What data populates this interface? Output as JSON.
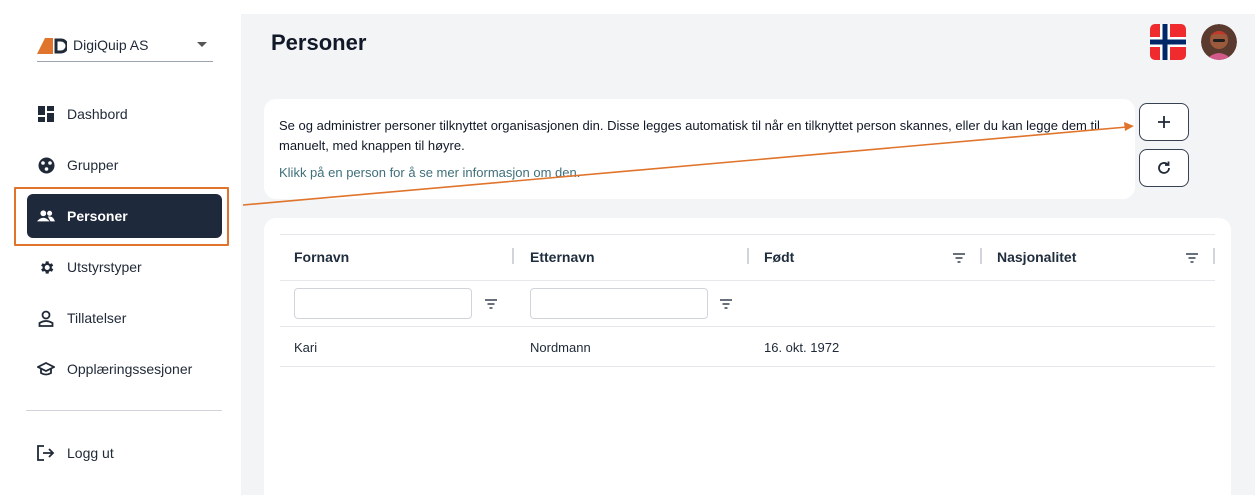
{
  "sidebar": {
    "org_name": "DigiQuip AS",
    "items": [
      {
        "label": "Dashbord",
        "icon": "dashboard-icon"
      },
      {
        "label": "Grupper",
        "icon": "groups-icon"
      },
      {
        "label": "Personer",
        "icon": "people-icon",
        "active": true
      },
      {
        "label": "Utstyrstyper",
        "icon": "gear-icon"
      },
      {
        "label": "Tillatelser",
        "icon": "permission-icon"
      },
      {
        "label": "Opplæringssesjoner",
        "icon": "graduation-cap-icon"
      }
    ],
    "logout_label": "Logg ut"
  },
  "header": {
    "title": "Personer",
    "flag": "norway-flag-icon",
    "avatar": "user-avatar"
  },
  "info": {
    "text": "Se og administrer personer tilknyttet organisasjonen din. Disse legges automatisk til når en tilknyttet person skannes, eller du kan legge dem til manuelt, med knappen til høyre.",
    "link": "Klikk på en person for å se mer informasjon om den."
  },
  "buttons": {
    "add": "plus-icon",
    "refresh": "refresh-icon"
  },
  "table": {
    "columns": [
      "Fornavn",
      "Etternavn",
      "Født",
      "Nasjonalitet"
    ],
    "rows": [
      {
        "fornavn": "Kari",
        "etternavn": "Nordmann",
        "fodt": "16. okt. 1972",
        "nasjonalitet": ""
      }
    ]
  },
  "colors": {
    "accent": "#e0742c",
    "nav_active": "#1e293b",
    "link": "#3f6f7a",
    "main_bg": "#f3f4f6"
  }
}
